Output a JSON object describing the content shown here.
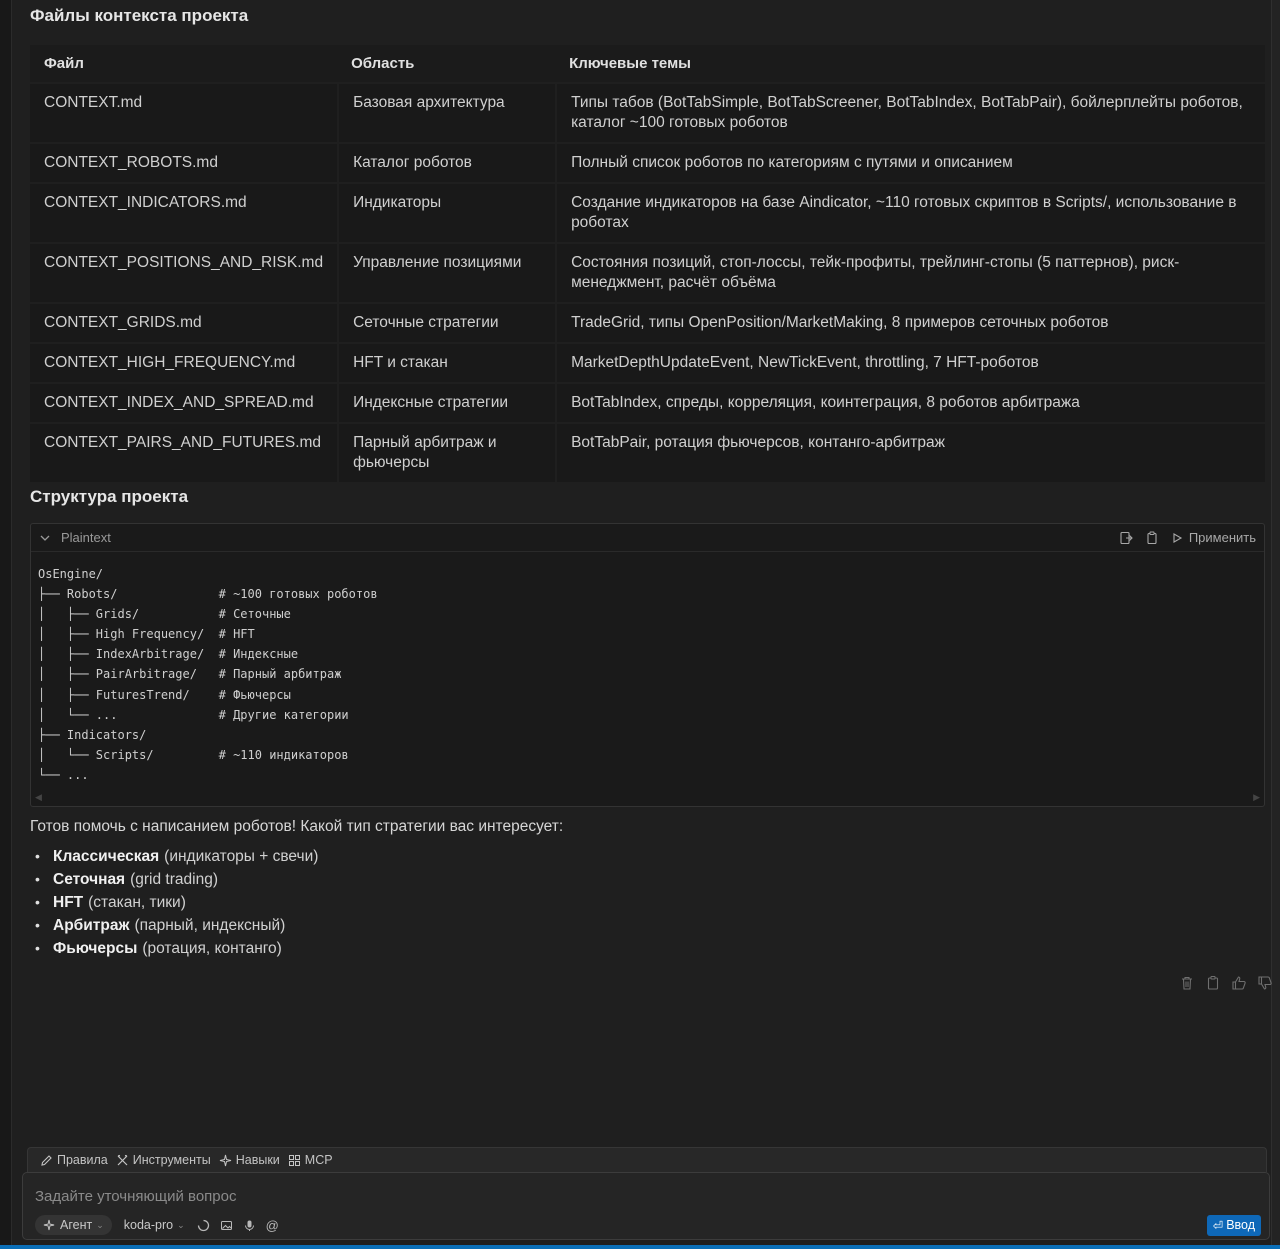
{
  "section1_title": "Файлы контекста проекта",
  "table": {
    "headers": [
      "Файл",
      "Область",
      "Ключевые темы"
    ],
    "rows": [
      {
        "file": "CONTEXT.md",
        "area": "Базовая архитектура",
        "topics": "Типы табов (BotTabSimple, BotTabScreener, BotTabIndex, BotTabPair), бойлерплейты роботов, каталог ~100 готовых роботов"
      },
      {
        "file": "CONTEXT_ROBOTS.md",
        "area": "Каталог роботов",
        "topics": "Полный список роботов по категориям с путями и описанием"
      },
      {
        "file": "CONTEXT_INDICATORS.md",
        "area": "Индикаторы",
        "topics": "Создание индикаторов на базе Aindicator, ~110 готовых скриптов в Scripts/, использование в роботах"
      },
      {
        "file": "CONTEXT_POSITIONS_AND_RISK.md",
        "area": "Управление позициями",
        "topics": "Состояния позиций, стоп-лоссы, тейк-профиты, трейлинг-стопы (5 паттернов), риск-менеджмент, расчёт объёма"
      },
      {
        "file": "CONTEXT_GRIDS.md",
        "area": "Сеточные стратегии",
        "topics": "TradeGrid, типы OpenPosition/MarketMaking, 8 примеров сеточных роботов"
      },
      {
        "file": "CONTEXT_HIGH_FREQUENCY.md",
        "area": "HFT и стакан",
        "topics": "MarketDepthUpdateEvent, NewTickEvent, throttling, 7 HFT-роботов"
      },
      {
        "file": "CONTEXT_INDEX_AND_SPREAD.md",
        "area": "Индексные стратегии",
        "topics": "BotTabIndex, спреды, корреляция, коинтеграция, 8 роботов арбитража"
      },
      {
        "file": "CONTEXT_PAIRS_AND_FUTURES.md",
        "area": "Парный арбитраж и фьючерсы",
        "topics": "BotTabPair, ротация фьючерсов, контанго-арбитраж"
      }
    ]
  },
  "section2_title": "Структура проекта",
  "code": {
    "language": "Plaintext",
    "apply_label": "Применить",
    "lines": [
      "OsEngine/",
      "├── Robots/              # ~100 готовых роботов",
      "│   ├── Grids/           # Сеточные",
      "│   ├── High Frequency/  # HFT",
      "│   ├── IndexArbitrage/  # Индексные",
      "│   ├── PairArbitrage/   # Парный арбитраж",
      "│   ├── FuturesTrend/    # Фьючерсы",
      "│   └── ...              # Другие категории",
      "├── Indicators/",
      "│   └── Scripts/         # ~110 индикаторов",
      "└── ..."
    ]
  },
  "intro": "Готов помочь с написанием роботов! Какой тип стратегии вас интересует:",
  "options": [
    {
      "bold": "Классическая",
      "rest": "(индикаторы + свечи)"
    },
    {
      "bold": "Сеточная",
      "rest": "(grid trading)"
    },
    {
      "bold": "HFT",
      "rest": "(стакан, тики)"
    },
    {
      "bold": "Арбитраж",
      "rest": "(парный, индексный)"
    },
    {
      "bold": "Фьючерсы",
      "rest": "(ротация, контанго)"
    }
  ],
  "toolbar": {
    "rules": "Правила",
    "tools": "Инструменты",
    "skills": "Навыки",
    "mcp": "MCP"
  },
  "input": {
    "placeholder": "Задайте уточняющий вопрос",
    "agent": "Агент",
    "model": "koda-pro",
    "send": "Ввод"
  },
  "colors": {
    "background": "#1f1f1f",
    "table_cell": "#191919",
    "accent": "#0e68b8"
  }
}
